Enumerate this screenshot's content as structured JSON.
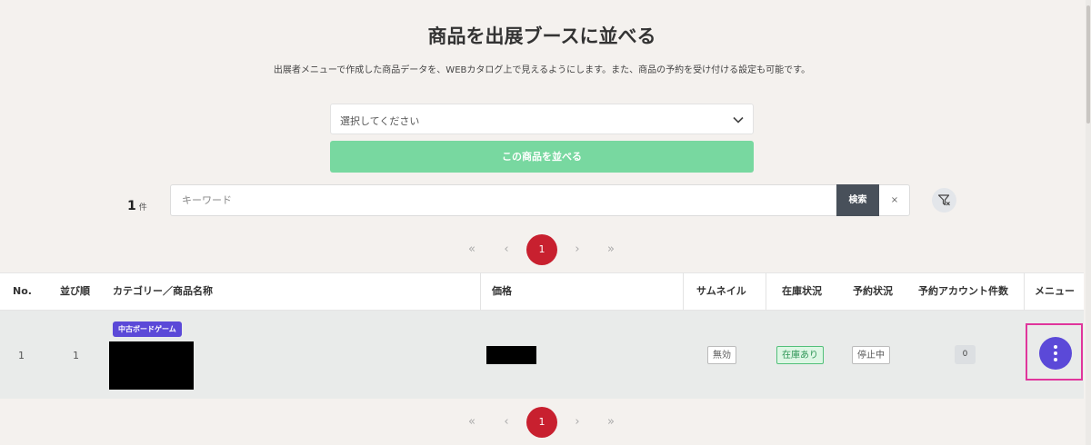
{
  "header": {
    "title": "商品を出展ブースに並べる",
    "description": "出展者メニューで作成した商品データを、WEBカタログ上で見えるようにします。また、商品の予約を受け付ける設定も可能です。"
  },
  "product_select": {
    "placeholder": "選択してください"
  },
  "add_button": {
    "label": "この商品を並べる"
  },
  "result": {
    "count": "1",
    "unit": "件"
  },
  "search": {
    "placeholder": "キーワード",
    "button_label": "検索",
    "clear_label": "×"
  },
  "pagination": {
    "first": "«",
    "prev": "‹",
    "current": "1",
    "next": "›",
    "last": "»"
  },
  "table": {
    "columns": [
      "No.",
      "並び順",
      "カテゴリー／商品名称",
      "価格",
      "サムネイル",
      "在庫状況",
      "予約状況",
      "予約アカウント件数",
      "メニュー"
    ],
    "rows": [
      {
        "no": "1",
        "order": "1",
        "category": "中古ボードゲーム",
        "thumbnail_status": "無効",
        "stock_status": "在庫あり",
        "reservation_status": "停止中",
        "reservation_count": "0"
      }
    ]
  },
  "colors": {
    "background": "#f4f1ee",
    "add_button": "#78d8a0",
    "search_button": "#48505a",
    "pagination_active": "#c8202f",
    "category_badge": "#5b49d8",
    "menu_button": "#5b49d8",
    "highlight_frame": "#e0359c"
  },
  "icons": {
    "select": "chevron-down-icon",
    "filter": "filter-clear-icon",
    "menu": "vertical-dots-icon"
  }
}
